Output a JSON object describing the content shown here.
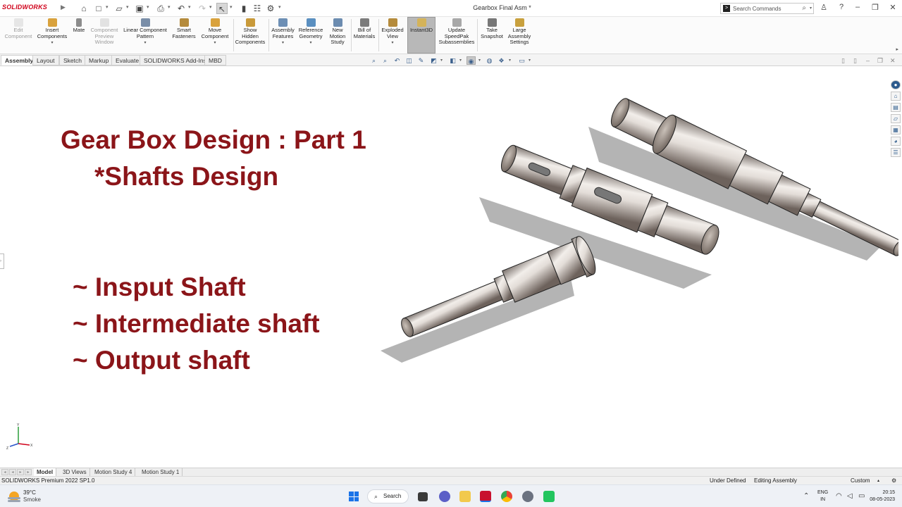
{
  "app": {
    "logo": "SOLIDWORKS",
    "document_title": "Gearbox Final Asm *",
    "search_placeholder": "Search Commands"
  },
  "ribbon": [
    {
      "label": "Edit\nComponent",
      "icon": "edit-component-icon",
      "disabled": true
    },
    {
      "label": "Insert\nComponents",
      "icon": "insert-components-icon",
      "disabled": false
    },
    {
      "label": "Mate",
      "icon": "mate-icon",
      "disabled": false
    },
    {
      "label": "Component\nPreview\nWindow",
      "icon": "preview-window-icon",
      "disabled": true
    },
    {
      "label": "Linear Component\nPattern",
      "icon": "linear-pattern-icon",
      "disabled": false
    },
    {
      "label": "Smart\nFasteners",
      "icon": "smart-fasteners-icon",
      "disabled": false
    },
    {
      "label": "Move\nComponent",
      "icon": "move-component-icon",
      "disabled": false
    },
    {
      "label": "Show\nHidden\nComponents",
      "icon": "show-hidden-icon",
      "disabled": false
    },
    {
      "label": "Assembly\nFeatures",
      "icon": "assembly-features-icon",
      "disabled": false
    },
    {
      "label": "Reference\nGeometry",
      "icon": "reference-geometry-icon",
      "disabled": false
    },
    {
      "label": "New\nMotion\nStudy",
      "icon": "motion-study-icon",
      "disabled": false
    },
    {
      "label": "Bill of\nMaterials",
      "icon": "bom-icon",
      "disabled": false
    },
    {
      "label": "Exploded\nView",
      "icon": "exploded-view-icon",
      "disabled": false
    },
    {
      "label": "Instant3D",
      "icon": "instant3d-icon",
      "disabled": false,
      "active": true
    },
    {
      "label": "Update\nSpeedPak\nSubassemblies",
      "icon": "speedpak-icon",
      "disabled": false
    },
    {
      "label": "Take\nSnapshot",
      "icon": "snapshot-icon",
      "disabled": false
    },
    {
      "label": "Large\nAssembly\nSettings",
      "icon": "large-assembly-icon",
      "disabled": false
    }
  ],
  "command_tabs": [
    "Assembly",
    "Layout",
    "Sketch",
    "Markup",
    "Evaluate",
    "SOLIDWORKS Add-Ins",
    "MBD"
  ],
  "active_command_tab": "Assembly",
  "graphics": {
    "title_line1": "Gear Box Design : Part 1",
    "title_line2": "*Shafts Design",
    "bullets": [
      "~ Insput Shaft",
      "~ Intermediate shaft",
      "~ Output shaft"
    ]
  },
  "model_tabs": [
    "Model",
    "3D Views",
    "Motion Study 4",
    "Motion Study 1"
  ],
  "active_model_tab": "Model",
  "status": {
    "product": "SOLIDWORKS Premium 2022 SP1.0",
    "state": "Under Defined",
    "mode": "Editing Assembly",
    "units": "Custom"
  },
  "taskbar": {
    "temperature": "39°C",
    "weather": "Smoke",
    "search": "Search",
    "lang1": "ENG",
    "lang2": "IN",
    "time": "20:15",
    "date": "08-05-2023"
  }
}
